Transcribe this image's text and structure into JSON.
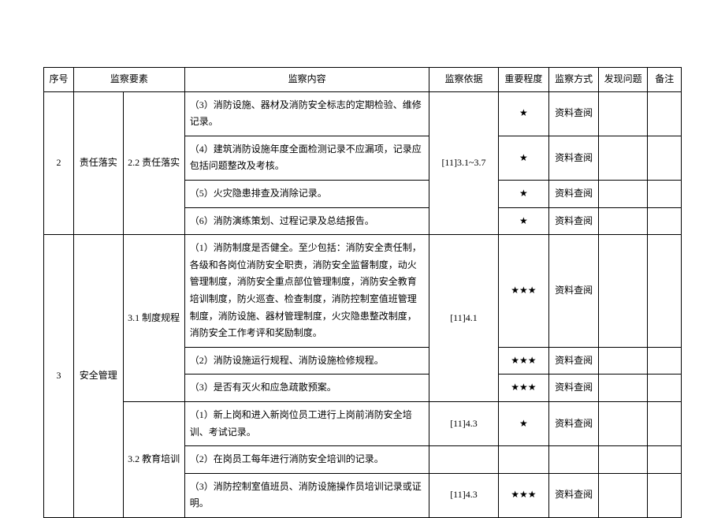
{
  "headers": {
    "seq": "序号",
    "element": "监察要素",
    "content": "监察内容",
    "basis": "监察依据",
    "importance": "重要程度",
    "method": "监察方式",
    "issue": "发现问题",
    "note": "备注"
  },
  "star1": "★",
  "star3": "★★★",
  "method_doc": "资料查阅",
  "group2": {
    "seq": "2",
    "el1": "责任落实",
    "el2": "2.2 责任落实",
    "basis": "[11]3.1~3.7",
    "rows": [
      {
        "content": "（3）消防设施、器材及消防安全标志的定期检验、维修记录。",
        "imp": "star1",
        "method": "method_doc"
      },
      {
        "content": "（4）建筑消防设施年度全面检测记录不应漏项，记录应包括问题整改及考核。",
        "imp": "star1",
        "method": "method_doc"
      },
      {
        "content": "（5）火灾隐患排查及消除记录。",
        "imp": "star1",
        "method": "method_doc"
      },
      {
        "content": "（6）消防演练策划、过程记录及总结报告。",
        "imp": "star1",
        "method": "method_doc"
      }
    ]
  },
  "group3": {
    "seq": "3",
    "el1": "安全管理",
    "sub1": {
      "el2": "3.1 制度规程",
      "basis": "[11]4.1",
      "rows": [
        {
          "content": "（1）消防制度是否健全。至少包括：消防安全责任制，各级和各岗位消防安全职责，消防安全监督制度，动火管理制度，消防安全重点部位管理制度，消防安全教育培训制度，防火巡查、检查制度，消防控制室值班管理制度，消防设施、器材管理制度，火灾隐患整改制度，消防安全工作考评和奖励制度。",
          "imp": "star3",
          "method": "method_doc"
        },
        {
          "content": "（2）消防设施运行规程、消防设施检修规程。",
          "imp": "star3",
          "method": "method_doc"
        },
        {
          "content": "（3）是否有灭火和应急疏散预案。",
          "imp": "star3",
          "method": "method_doc"
        }
      ]
    },
    "sub2": {
      "el2": "3.2 教育培训",
      "rows": [
        {
          "content": "（1）新上岗和进入新岗位员工进行上岗前消防安全培训、考试记录。",
          "basis": "[11]4.3",
          "imp": "star1",
          "method": "method_doc"
        },
        {
          "content": "（2）在岗员工每年进行消防安全培训的记录。",
          "basis": "",
          "imp": "",
          "method": ""
        },
        {
          "content": "（3）消防控制室值班员、消防设施操作员培训记录或证明。",
          "basis": "[11]4.3",
          "imp": "star3",
          "method": "method_doc"
        }
      ]
    }
  }
}
